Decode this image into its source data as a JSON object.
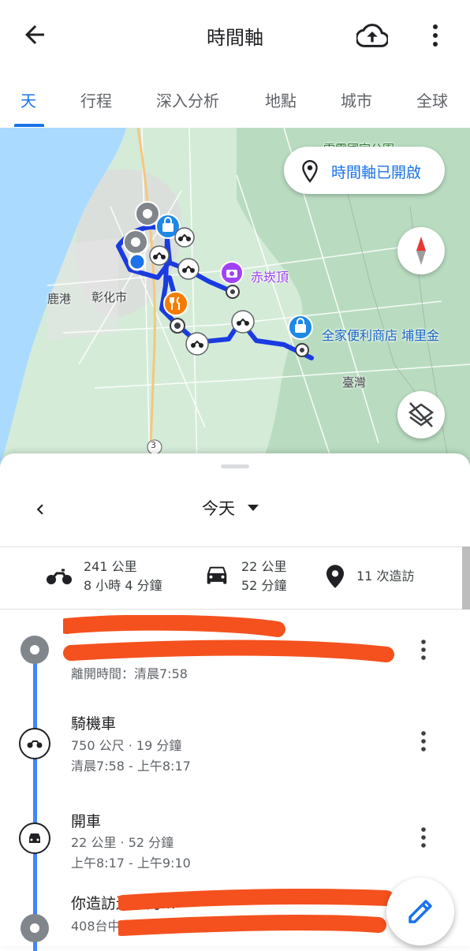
{
  "header": {
    "title": "時間軸",
    "back_icon": "arrow-back-icon",
    "cloud_icon": "cloud-upload-icon",
    "more_icon": "more-vert-icon"
  },
  "tabs": [
    {
      "label": "天",
      "active": true
    },
    {
      "label": "行程",
      "active": false
    },
    {
      "label": "深入分析",
      "active": false
    },
    {
      "label": "地點",
      "active": false
    },
    {
      "label": "城市",
      "active": false
    },
    {
      "label": "全球",
      "active": false
    }
  ],
  "map": {
    "status_label": "時間軸已開啟",
    "labels": {
      "lukang": "鹿港",
      "changhua": "彰化市",
      "taiwan": "臺灣",
      "national_park": "雪霸國家公園"
    },
    "poi": {
      "chitan": "赤崁頂",
      "familymart": "全家便利商店 埔里金"
    },
    "route_number": "3",
    "colors": {
      "route": "#1a3be0",
      "water": "#aadaff",
      "land": "#cfe8d6"
    }
  },
  "sheet": {
    "date": "今天",
    "stats": {
      "moto_distance": "241 公里",
      "moto_time": "8 小時 4 分鐘",
      "car_distance": "22 公里",
      "car_time": "52 分鐘",
      "visits": "11 次造訪"
    },
    "entries": [
      {
        "type": "place",
        "sub": "離開時間：清晨7:58"
      },
      {
        "type": "motorcycle",
        "title": "騎機車",
        "sub1": "750 公尺 · 19 分鐘",
        "sub2": "清晨7:58 - 上午8:17"
      },
      {
        "type": "car",
        "title": "開車",
        "sub1": "22 公里 · 52 分鐘",
        "sub2": "上午8:17 - 上午9:10"
      },
      {
        "type": "place",
        "title": "你造訪過了的…",
        "sub1": "408台中市南屯區…"
      }
    ]
  }
}
